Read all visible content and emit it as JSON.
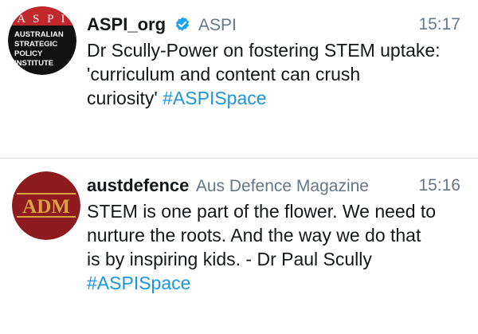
{
  "tweets": [
    {
      "display_name": "ASPI_org",
      "verified": true,
      "handle": "ASPI",
      "time": "15:17",
      "text_lines": [
        "Dr Scully-Power on fostering STEM uptake:",
        "'curriculum and content can crush",
        "curiosity' "
      ],
      "hashtag": "#ASPISpace",
      "avatar": {
        "top_text": "A S P I",
        "lines": [
          "AUSTRALIAN",
          "STRATEGIC",
          "POLICY",
          "INSTITUTE"
        ]
      }
    },
    {
      "display_name": "austdefence",
      "handle": "Aus Defence Magazine",
      "time": "15:16",
      "text_lines": [
        "STEM is one part of the flower. We need to",
        "nurture the roots. And the way we do that",
        "is by inspiring kids. - Dr Paul Scully"
      ],
      "hashtag": "#ASPISpace",
      "avatar": {
        "logo": "ADM"
      }
    }
  ],
  "colors": {
    "link": "#1b95e0",
    "muted": "#657786",
    "text": "#14171a",
    "verified": "#1da1f2",
    "aspi_red": "#c1282d",
    "adm_red": "#8e1b1e",
    "adm_gold": "#d9a441"
  }
}
